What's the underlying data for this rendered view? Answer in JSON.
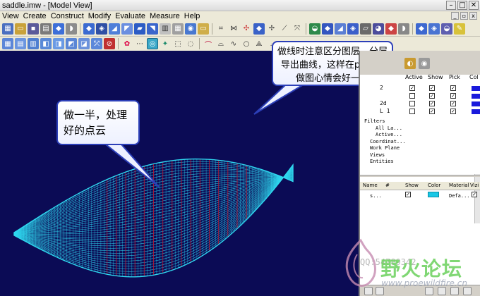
{
  "window": {
    "title": "saddle.imw - [Model View]",
    "min_glyph": "–",
    "max_glyph": "□",
    "close_glyph": "✕"
  },
  "menu": [
    "View",
    "Create",
    "Construct",
    "Modify",
    "Evaluate",
    "Measure",
    "Help"
  ],
  "callouts": {
    "left": "做一半，处理好的点云",
    "right": "做线时注意区分图层，分层导出曲线，这样在proe里做图心情会好一些"
  },
  "layers": {
    "columns": [
      "Active",
      "Show",
      "Pick",
      "Col"
    ],
    "rows": [
      {
        "name": "2",
        "active": true,
        "show": true,
        "pick": true
      },
      {
        "name": "",
        "active": false,
        "show": true,
        "pick": true
      },
      {
        "name": "2d",
        "active": false,
        "show": true,
        "pick": true
      },
      {
        "name": "L 1",
        "active": false,
        "show": true,
        "pick": true
      }
    ],
    "layer_color": "#1a1adc"
  },
  "tree": [
    "Filters",
    "All La...",
    "Active...",
    "Coordinat...",
    "Work Plane",
    "Views",
    "Entities"
  ],
  "entities": {
    "columns": [
      "Name",
      "#",
      "Show",
      "Color",
      "Material",
      "Vizi"
    ],
    "rows": [
      {
        "name": "s...",
        "show": true,
        "color": "#19c7e6",
        "material": "Defa...",
        "vizi": true
      }
    ]
  },
  "watermark": {
    "text": "野火论坛",
    "url": "www.proewildfire.cn",
    "code": "QQ:54789342"
  },
  "colors": {
    "viewport_bg": "#0b0b55",
    "mesh_cyan": "#2fd8f0",
    "mesh_red": "#c01830",
    "callout_border": "#2c3fb8"
  },
  "icons": [
    "new-icon",
    "open-icon",
    "save-icon",
    "print-icon",
    "cut-icon",
    "copy-icon",
    "paste-icon",
    "undo-icon",
    "redo-icon",
    "surface-icon",
    "curve-icon",
    "point-icon",
    "cloud-icon",
    "shade-icon",
    "wireframe-icon",
    "fit-icon",
    "zoom-icon",
    "rotate-icon",
    "pan-icon",
    "layer-icon"
  ]
}
